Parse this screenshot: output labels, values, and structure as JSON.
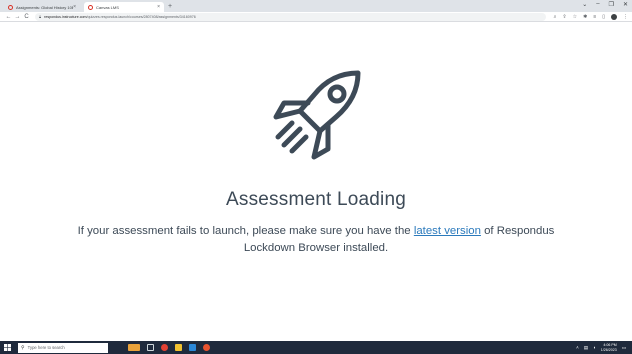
{
  "browser": {
    "tabs": [
      {
        "title": "Assignments: Global History 10B",
        "close": "×",
        "favicon": "canvas-icon",
        "active": false
      },
      {
        "title": "Canvas LMS",
        "close": "×",
        "favicon": "canvas-icon",
        "active": true
      }
    ],
    "new_tab": "+",
    "url_domain": "respondus.instructure.com",
    "url_path": "/quizzes.respondus.launch/courses/2807408/assignments/34160976",
    "window_controls": [
      "⌄",
      "–",
      "❐",
      "✕"
    ]
  },
  "page": {
    "heading": "Assessment Loading",
    "message_before": "If your assessment fails to launch, please make sure you have the ",
    "message_link": "latest version",
    "message_after": " of Respondus Lockdown Browser installed.",
    "illustration": "rocket-icon",
    "link_color": "#2b7abc",
    "text_color": "#3d4a57"
  },
  "taskbar": {
    "search_placeholder": "Type here to search",
    "time": "4:06 PM",
    "date": "1/26/2023"
  }
}
